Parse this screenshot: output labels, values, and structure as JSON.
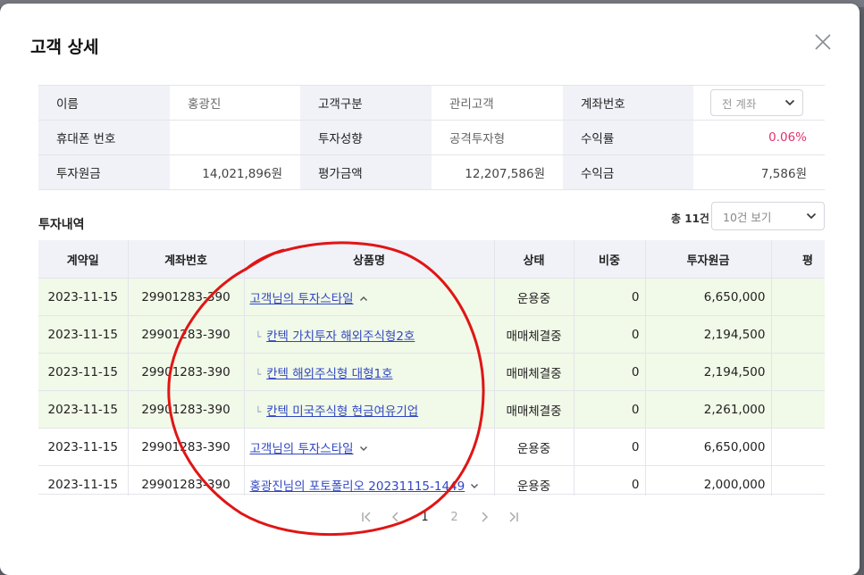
{
  "modal": {
    "title": "고객 상세"
  },
  "info": {
    "rows": [
      [
        {
          "label": "이름"
        },
        {
          "value": "홍광진"
        },
        {
          "label": "고객구분"
        },
        {
          "value": "관리고객"
        },
        {
          "label": "계좌번호"
        },
        {
          "select": "전 계좌"
        }
      ],
      [
        {
          "label": "휴대폰 번호"
        },
        {
          "value": ""
        },
        {
          "label": "투자성향"
        },
        {
          "value": "공격투자형"
        },
        {
          "label": "수익률"
        },
        {
          "value": "0.06%"
        }
      ],
      [
        {
          "label": "투자원금"
        },
        {
          "value": "14,021,896원"
        },
        {
          "label": "평가금액"
        },
        {
          "value": "12,207,586원"
        },
        {
          "label": "수익금"
        },
        {
          "value": "7,586원"
        }
      ]
    ],
    "rate_color": "#e0336e"
  },
  "history": {
    "title": "투자내역",
    "count_label": "총 11건",
    "page_size": "10건 보기",
    "columns": [
      "계약일",
      "계좌번호",
      "상품명",
      "상태",
      "비중",
      "투자원금",
      "평"
    ],
    "rows": [
      {
        "date": "2023-11-15",
        "account": "29901283-390",
        "name": "고객님의 투자스타일",
        "status": "운용중",
        "weight": "0",
        "principal": "6,650,000",
        "sub": false,
        "highlight": true,
        "toggle": "up"
      },
      {
        "date": "2023-11-15",
        "account": "29901283-390",
        "name": "칸텍 가치투자 해외주식형2호",
        "status": "매매체결중",
        "weight": "0",
        "principal": "2,194,500",
        "sub": true,
        "highlight": true,
        "toggle": ""
      },
      {
        "date": "2023-11-15",
        "account": "29901283-390",
        "name": "칸텍 해외주식형 대형1호",
        "status": "매매체결중",
        "weight": "0",
        "principal": "2,194,500",
        "sub": true,
        "highlight": true,
        "toggle": ""
      },
      {
        "date": "2023-11-15",
        "account": "29901283-390",
        "name": "칸텍 미국주식형 현금여유기업",
        "status": "매매체결중",
        "weight": "0",
        "principal": "2,261,000",
        "sub": true,
        "highlight": true,
        "toggle": ""
      },
      {
        "date": "2023-11-15",
        "account": "29901283-390",
        "name": "고객님의 투자스타일",
        "status": "운용중",
        "weight": "0",
        "principal": "6,650,000",
        "sub": false,
        "highlight": false,
        "toggle": "down"
      },
      {
        "date": "2023-11-15",
        "account": "29901283-390",
        "name": "홍광진님의 포토폴리오 20231115-1449",
        "status": "운용중",
        "weight": "0",
        "principal": "2,000,000",
        "sub": false,
        "highlight": false,
        "toggle": "down"
      }
    ],
    "highlight_color": "#f1f9e8",
    "link_color": "#3047c2"
  },
  "pagination": {
    "pages": [
      "1",
      "2"
    ],
    "current": "1"
  },
  "annotation": {
    "color": "#e01515",
    "shape": "hand-drawn-circle"
  }
}
